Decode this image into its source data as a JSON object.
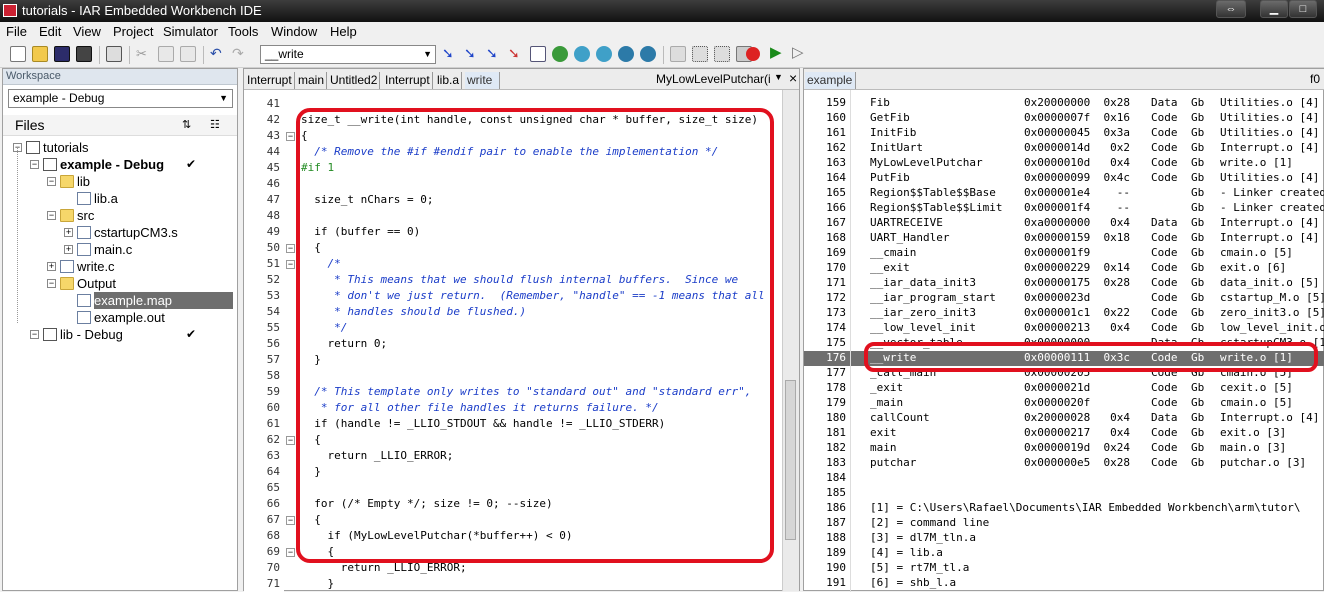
{
  "window": {
    "title": "tutorials - IAR Embedded Workbench IDE"
  },
  "menu": [
    "File",
    "Edit",
    "View",
    "Project",
    "Simulator",
    "Tools",
    "Window",
    "Help"
  ],
  "toolbar": {
    "combo_value": "__write"
  },
  "workspace": {
    "header": "Workspace",
    "config": "example - Debug",
    "files_label": "Files",
    "tree": [
      {
        "label": "tutorials",
        "level": 0,
        "type": "proj"
      },
      {
        "label": "example - Debug",
        "level": 1,
        "type": "proj",
        "bold": true,
        "check": "✔"
      },
      {
        "label": "lib",
        "level": 2,
        "type": "folder"
      },
      {
        "label": "lib.a",
        "level": 3,
        "type": "file"
      },
      {
        "label": "src",
        "level": 2,
        "type": "folder"
      },
      {
        "label": "cstartupCM3.s",
        "level": 3,
        "type": "file"
      },
      {
        "label": "main.c",
        "level": 3,
        "type": "file"
      },
      {
        "label": "write.c",
        "level": 2,
        "type": "file"
      },
      {
        "label": "Output",
        "level": 2,
        "type": "folder"
      },
      {
        "label": "example.map",
        "level": 3,
        "type": "file",
        "selected": true
      },
      {
        "label": "example.out",
        "level": 3,
        "type": "file"
      },
      {
        "label": "lib - Debug",
        "level": 1,
        "type": "proj",
        "check": "✔"
      }
    ]
  },
  "editor": {
    "tabs": [
      "Interrupt",
      "main",
      "Untitled2",
      "Interrupt",
      "lib.a",
      "write"
    ],
    "active_tab": "write",
    "function_combo": "MyLowLevelPutchar(int)",
    "close": "×",
    "lines": [
      {
        "n": "41",
        "t": "",
        "k": ""
      },
      {
        "n": "42",
        "t": "size_t __write(int handle, const unsigned char * buffer, size_t size)",
        "k": ""
      },
      {
        "n": "43",
        "t": "{",
        "k": ""
      },
      {
        "n": "44",
        "t": "  /* Remove the #if #endif pair to enable the implementation */",
        "k": "cmt"
      },
      {
        "n": "45",
        "t": "#if 1",
        "k": "pre"
      },
      {
        "n": "46",
        "t": "",
        "k": ""
      },
      {
        "n": "47",
        "t": "  size_t nChars = 0;",
        "k": ""
      },
      {
        "n": "48",
        "t": "",
        "k": ""
      },
      {
        "n": "49",
        "t": "  if (buffer == 0)",
        "k": ""
      },
      {
        "n": "50",
        "t": "  {",
        "k": ""
      },
      {
        "n": "51",
        "t": "    /*",
        "k": "cmt"
      },
      {
        "n": "52",
        "t": "     * This means that we should flush internal buffers.  Since we",
        "k": "cmt"
      },
      {
        "n": "53",
        "t": "     * don't we just return.  (Remember, \"handle\" == -1 means that all",
        "k": "cmt"
      },
      {
        "n": "54",
        "t": "     * handles should be flushed.)",
        "k": "cmt"
      },
      {
        "n": "55",
        "t": "     */",
        "k": "cmt"
      },
      {
        "n": "56",
        "t": "    return 0;",
        "k": ""
      },
      {
        "n": "57",
        "t": "  }",
        "k": ""
      },
      {
        "n": "58",
        "t": "",
        "k": ""
      },
      {
        "n": "59",
        "t": "  /* This template only writes to \"standard out\" and \"standard err\",",
        "k": "cmt"
      },
      {
        "n": "60",
        "t": "   * for all other file handles it returns failure. */",
        "k": "cmt"
      },
      {
        "n": "61",
        "t": "  if (handle != _LLIO_STDOUT && handle != _LLIO_STDERR)",
        "k": ""
      },
      {
        "n": "62",
        "t": "  {",
        "k": ""
      },
      {
        "n": "63",
        "t": "    return _LLIO_ERROR;",
        "k": ""
      },
      {
        "n": "64",
        "t": "  }",
        "k": ""
      },
      {
        "n": "65",
        "t": "",
        "k": ""
      },
      {
        "n": "66",
        "t": "  for (/* Empty */; size != 0; --size)",
        "k": ""
      },
      {
        "n": "67",
        "t": "  {",
        "k": ""
      },
      {
        "n": "68",
        "t": "    if (MyLowLevelPutchar(*buffer++) < 0)",
        "k": ""
      },
      {
        "n": "69",
        "t": "    {",
        "k": ""
      },
      {
        "n": "70",
        "t": "      return _LLIO_ERROR;",
        "k": ""
      },
      {
        "n": "71",
        "t": "    }",
        "k": ""
      }
    ]
  },
  "map": {
    "tab": "example",
    "right_label": "f0",
    "rows": [
      {
        "n": "159",
        "name": "Fib",
        "addr": "0x20000000",
        "size": "0x28",
        "kind": "Data",
        "scope": "Gb",
        "obj": "Utilities.o [4]"
      },
      {
        "n": "160",
        "name": "GetFib",
        "addr": "0x0000007f",
        "size": "0x16",
        "kind": "Code",
        "scope": "Gb",
        "obj": "Utilities.o [4]"
      },
      {
        "n": "161",
        "name": "InitFib",
        "addr": "0x00000045",
        "size": "0x3a",
        "kind": "Code",
        "scope": "Gb",
        "obj": "Utilities.o [4]"
      },
      {
        "n": "162",
        "name": "InitUart",
        "addr": "0x0000014d",
        "size": "0x2",
        "kind": "Code",
        "scope": "Gb",
        "obj": "Interrupt.o [4]"
      },
      {
        "n": "163",
        "name": "MyLowLevelPutchar",
        "addr": "0x0000010d",
        "size": "0x4",
        "kind": "Code",
        "scope": "Gb",
        "obj": "write.o [1]"
      },
      {
        "n": "164",
        "name": "PutFib",
        "addr": "0x00000099",
        "size": "0x4c",
        "kind": "Code",
        "scope": "Gb",
        "obj": "Utilities.o [4]"
      },
      {
        "n": "165",
        "name": "Region$$Table$$Base",
        "addr": "0x000001e4",
        "size": "--",
        "kind": "",
        "scope": "Gb",
        "obj": "- Linker created"
      },
      {
        "n": "166",
        "name": "Region$$Table$$Limit",
        "addr": "0x000001f4",
        "size": "--",
        "kind": "",
        "scope": "Gb",
        "obj": "- Linker created"
      },
      {
        "n": "167",
        "name": "UARTRECEIVE",
        "addr": "0xa0000000",
        "size": "0x4",
        "kind": "Data",
        "scope": "Gb",
        "obj": "Interrupt.o [4]"
      },
      {
        "n": "168",
        "name": "UART_Handler",
        "addr": "0x00000159",
        "size": "0x18",
        "kind": "Code",
        "scope": "Gb",
        "obj": "Interrupt.o [4]"
      },
      {
        "n": "169",
        "name": "__cmain",
        "addr": "0x000001f9",
        "size": "",
        "kind": "Code",
        "scope": "Gb",
        "obj": "cmain.o [5]"
      },
      {
        "n": "170",
        "name": "__exit",
        "addr": "0x00000229",
        "size": "0x14",
        "kind": "Code",
        "scope": "Gb",
        "obj": "exit.o [6]"
      },
      {
        "n": "171",
        "name": "__iar_data_init3",
        "addr": "0x00000175",
        "size": "0x28",
        "kind": "Code",
        "scope": "Gb",
        "obj": "data_init.o [5]"
      },
      {
        "n": "172",
        "name": "__iar_program_start",
        "addr": "0x0000023d",
        "size": "",
        "kind": "Code",
        "scope": "Gb",
        "obj": "cstartup_M.o [5]"
      },
      {
        "n": "173",
        "name": "__iar_zero_init3",
        "addr": "0x000001c1",
        "size": "0x22",
        "kind": "Code",
        "scope": "Gb",
        "obj": "zero_init3.o [5]"
      },
      {
        "n": "174",
        "name": "__low_level_init",
        "addr": "0x00000213",
        "size": "0x4",
        "kind": "Code",
        "scope": "Gb",
        "obj": "low_level_init.o"
      },
      {
        "n": "175",
        "name": "__vector_table",
        "addr": "0x00000000",
        "size": "",
        "kind": "Data",
        "scope": "Gb",
        "obj": "cstartupCM3.o [1]"
      },
      {
        "n": "176",
        "name": "__write",
        "addr": "0x00000111",
        "size": "0x3c",
        "kind": "Code",
        "scope": "Gb",
        "obj": "write.o [1]",
        "sel": true
      },
      {
        "n": "177",
        "name": "_call_main",
        "addr": "0x00000205",
        "size": "",
        "kind": "Code",
        "scope": "Gb",
        "obj": "cmain.o [5]"
      },
      {
        "n": "178",
        "name": "_exit",
        "addr": "0x0000021d",
        "size": "",
        "kind": "Code",
        "scope": "Gb",
        "obj": "cexit.o [5]"
      },
      {
        "n": "179",
        "name": "_main",
        "addr": "0x0000020f",
        "size": "",
        "kind": "Code",
        "scope": "Gb",
        "obj": "cmain.o [5]"
      },
      {
        "n": "180",
        "name": "callCount",
        "addr": "0x20000028",
        "size": "0x4",
        "kind": "Data",
        "scope": "Gb",
        "obj": "Interrupt.o [4]"
      },
      {
        "n": "181",
        "name": "exit",
        "addr": "0x00000217",
        "size": "0x4",
        "kind": "Code",
        "scope": "Gb",
        "obj": "exit.o [3]"
      },
      {
        "n": "182",
        "name": "main",
        "addr": "0x0000019d",
        "size": "0x24",
        "kind": "Code",
        "scope": "Gb",
        "obj": "main.o [3]"
      },
      {
        "n": "183",
        "name": "putchar",
        "addr": "0x000000e5",
        "size": "0x28",
        "kind": "Code",
        "scope": "Gb",
        "obj": "putchar.o [3]"
      },
      {
        "n": "184",
        "name": "",
        "addr": "",
        "size": "",
        "kind": "",
        "scope": "",
        "obj": ""
      },
      {
        "n": "185",
        "name": "",
        "addr": "",
        "size": "",
        "kind": "",
        "scope": "",
        "obj": ""
      },
      {
        "n": "186",
        "name": "[1] = C:\\Users\\Rafael\\Documents\\IAR Embedded Workbench\\arm\\tutor\\",
        "addr": "",
        "size": "",
        "kind": "",
        "scope": "",
        "obj": ""
      },
      {
        "n": "187",
        "name": "[2] = command line",
        "addr": "",
        "size": "",
        "kind": "",
        "scope": "",
        "obj": ""
      },
      {
        "n": "188",
        "name": "[3] = dl7M_tln.a",
        "addr": "",
        "size": "",
        "kind": "",
        "scope": "",
        "obj": ""
      },
      {
        "n": "189",
        "name": "[4] = lib.a",
        "addr": "",
        "size": "",
        "kind": "",
        "scope": "",
        "obj": ""
      },
      {
        "n": "190",
        "name": "[5] = rt7M_tl.a",
        "addr": "",
        "size": "",
        "kind": "",
        "scope": "",
        "obj": ""
      },
      {
        "n": "191",
        "name": "[6] = shb_l.a",
        "addr": "",
        "size": "",
        "kind": "",
        "scope": "",
        "obj": ""
      }
    ]
  },
  "colors": {
    "highlight_oval": "#e1101e",
    "selection": "#6e6e6e"
  }
}
